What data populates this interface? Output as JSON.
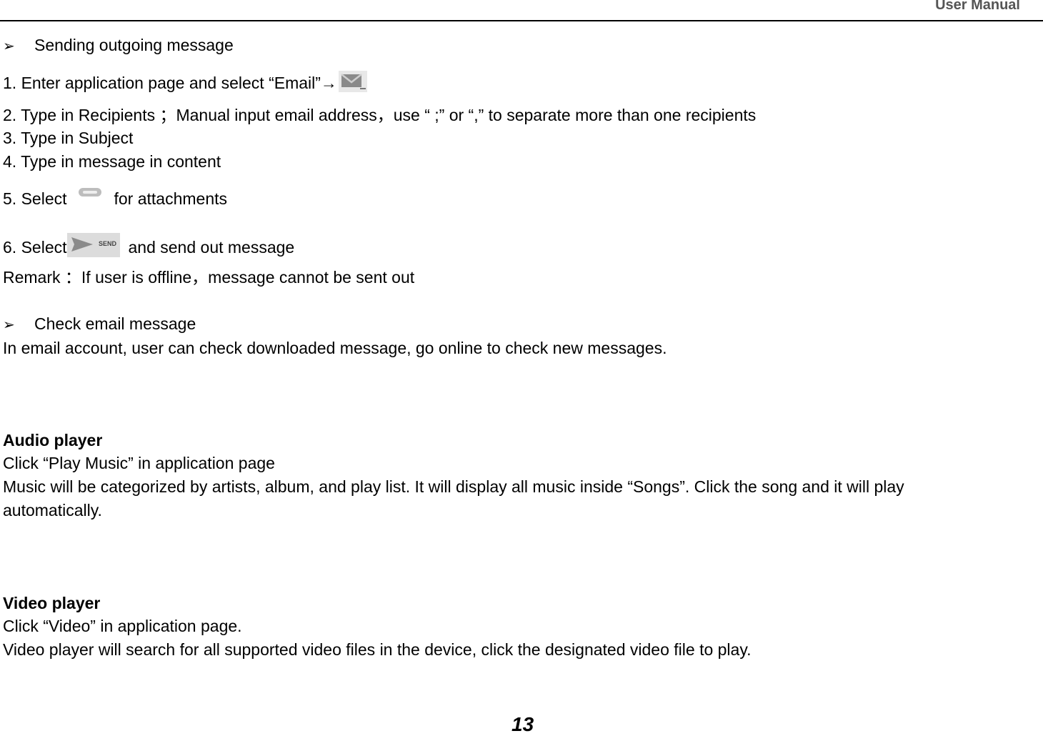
{
  "header": {
    "title": "User Manual"
  },
  "sections": {
    "sending": {
      "bullet_label": "Sending outgoing message",
      "step1": "1. Enter application page and select “Email”→",
      "step2": "2. Type in Recipients ；Manual input email address，use “ ;” or “,” to separate more than one recipients",
      "step3": "3. Type in Subject",
      "step4": "4. Type in message in content",
      "step5_before": "5. Select",
      "step5_after": "for attachments",
      "step6_before": "6. Select",
      "step6_after": "and send out message",
      "send_icon_label": "SEND",
      "remark": "Remark ：If user is offline，message cannot be sent out"
    },
    "check": {
      "bullet_label": "Check email message",
      "text": "In email account, user can check downloaded message, go online to check new messages."
    },
    "audio": {
      "heading": "Audio player",
      "line1": "Click “Play Music” in application page",
      "line2": "Music will be categorized by artists, album, and play list. It will display all music inside “Songs”. Click the song and it will play",
      "line3": "automatically."
    },
    "video": {
      "heading": "Video player",
      "line1": "Click “Video” in application page.",
      "line2": "Video player will search for all supported video files in the device, click the designated video file to play."
    }
  },
  "icons": {
    "bullet": "➢",
    "email": "email-compose-icon",
    "attachment": "paperclip-icon",
    "send": "send-icon"
  },
  "footer": {
    "page_number": "13"
  }
}
